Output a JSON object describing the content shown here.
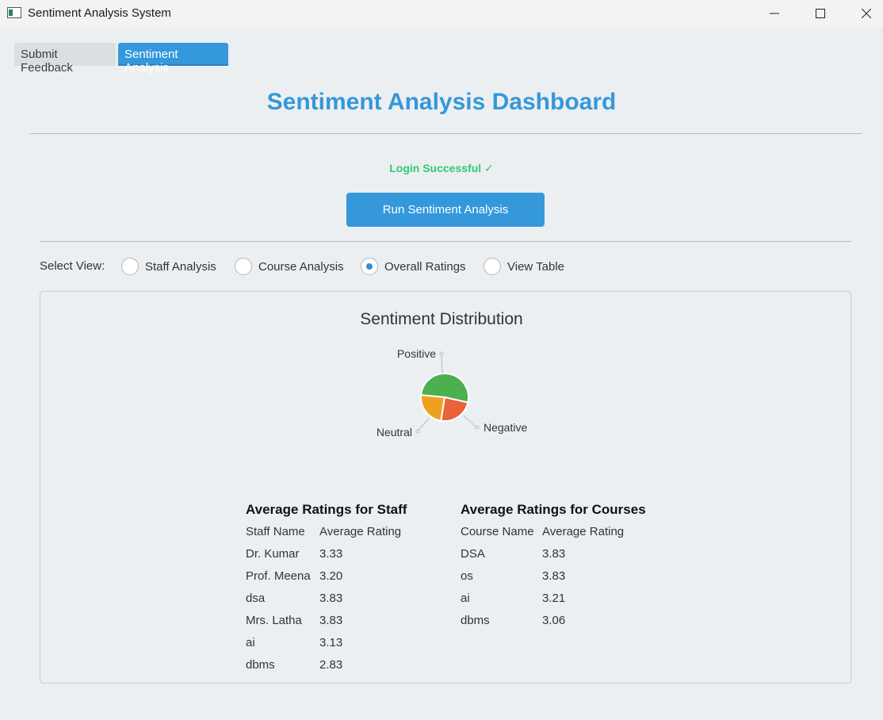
{
  "window": {
    "title": "Sentiment Analysis System"
  },
  "tabs": [
    {
      "label": "Submit Feedback",
      "selected": false
    },
    {
      "label": "Sentiment Analysis",
      "selected": true
    }
  ],
  "dashboard": {
    "title": "Sentiment Analysis Dashboard",
    "status": "Login Successful ✓",
    "run_button": "Run Sentiment Analysis"
  },
  "view_selector": {
    "label": "Select View:",
    "options": [
      {
        "label": "Staff Analysis",
        "checked": false
      },
      {
        "label": "Course Analysis",
        "checked": false
      },
      {
        "label": "Overall Ratings",
        "checked": true
      },
      {
        "label": "View Table",
        "checked": false
      }
    ]
  },
  "chart_data": {
    "type": "pie",
    "title": "Sentiment Distribution",
    "slices": [
      {
        "label": "Positive",
        "value": 52,
        "color": "#4caf50"
      },
      {
        "label": "Negative",
        "value": 24,
        "color": "#e8623a"
      },
      {
        "label": "Neutral",
        "value": 24,
        "color": "#f0a020"
      }
    ]
  },
  "staff_ratings": {
    "title": "Average Ratings for Staff",
    "headers": [
      "Staff Name",
      "Average Rating"
    ],
    "rows": [
      [
        "Dr. Kumar",
        "3.33"
      ],
      [
        "Prof. Meena",
        "3.20"
      ],
      [
        "dsa",
        "3.83"
      ],
      [
        "Mrs. Latha",
        "3.83"
      ],
      [
        "ai",
        "3.13"
      ],
      [
        "dbms",
        "2.83"
      ]
    ]
  },
  "course_ratings": {
    "title": "Average Ratings for Courses",
    "headers": [
      "Course Name",
      "Average Rating"
    ],
    "rows": [
      [
        "DSA",
        "3.83"
      ],
      [
        "os",
        "3.83"
      ],
      [
        "ai",
        "3.21"
      ],
      [
        "dbms",
        "3.06"
      ]
    ]
  },
  "colors": {
    "accent": "#3498db",
    "success": "#2ecc71"
  }
}
